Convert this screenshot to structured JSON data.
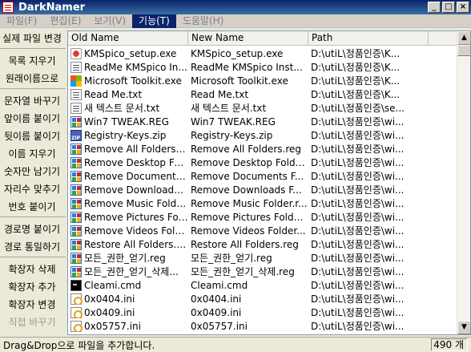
{
  "window": {
    "title": "DarkNamer"
  },
  "menu": [
    "파일(F)",
    "편집(E)",
    "보기(V)",
    "기능(T)",
    "도움말(H)"
  ],
  "sidebar": {
    "group1": [
      "실제 파일 변경"
    ],
    "group2": [
      "목록 지우기",
      "원래이름으로"
    ],
    "group3": [
      "문자열 바꾸기",
      "앞이름 붙이기",
      "뒷이름 붙이기",
      "이름 지우기",
      "숫자만 남기기",
      "자리수 맞추기",
      "번호 붙이기"
    ],
    "group4": [
      "경로명 붙이기",
      "경로 통일하기"
    ],
    "group5": [
      "확장자 삭제",
      "확장자 추가",
      "확장자 변경",
      "직접 바꾸기"
    ]
  },
  "list": {
    "headers": {
      "old": "Old Name",
      "new": "New Name",
      "path": "Path"
    },
    "rows": [
      {
        "icon": "setup",
        "old": "KMSpico_setup.exe",
        "new": "KMSpico_setup.exe",
        "path": "D:\\utiL\\정품인증\\K..."
      },
      {
        "icon": "text",
        "old": "ReadMe KMSpico In...",
        "new": "ReadMe KMSpico Inst...",
        "path": "D:\\utiL\\정품인증\\K..."
      },
      {
        "icon": "ms",
        "old": "Microsoft Toolkit.exe",
        "new": "Microsoft Toolkit.exe",
        "path": "D:\\utiL\\정품인증\\K..."
      },
      {
        "icon": "text",
        "old": "Read Me.txt",
        "new": "Read Me.txt",
        "path": "D:\\utiL\\정품인증\\K..."
      },
      {
        "icon": "text",
        "old": "새 텍스트 문서.txt",
        "new": "새 텍스트 문서.txt",
        "path": "D:\\utiL\\정품인증\\se..."
      },
      {
        "icon": "reg",
        "old": "Win7 TWEAK.REG",
        "new": "Win7 TWEAK.REG",
        "path": "D:\\utiL\\정품인증\\wi..."
      },
      {
        "icon": "zip",
        "old": "Registry-Keys.zip",
        "new": "Registry-Keys.zip",
        "path": "D:\\utiL\\정품인증\\wi..."
      },
      {
        "icon": "reg",
        "old": "Remove All Folders.reg",
        "new": "Remove All Folders.reg",
        "path": "D:\\utiL\\정품인증\\wi..."
      },
      {
        "icon": "reg",
        "old": "Remove Desktop Fol...",
        "new": "Remove Desktop Folde...",
        "path": "D:\\utiL\\정품인증\\wi..."
      },
      {
        "icon": "reg",
        "old": "Remove Documents ...",
        "new": "Remove Documents F...",
        "path": "D:\\utiL\\정품인증\\wi..."
      },
      {
        "icon": "reg",
        "old": "Remove Downloads ...",
        "new": "Remove Downloads F...",
        "path": "D:\\utiL\\정품인증\\wi..."
      },
      {
        "icon": "reg",
        "old": "Remove Music Folde...",
        "new": "Remove Music Folder.r...",
        "path": "D:\\utiL\\정품인증\\wi..."
      },
      {
        "icon": "reg",
        "old": "Remove Pictures Fol...",
        "new": "Remove Pictures Folde...",
        "path": "D:\\utiL\\정품인증\\wi..."
      },
      {
        "icon": "reg",
        "old": "Remove Videos Fold...",
        "new": "Remove Videos Folder...",
        "path": "D:\\utiL\\정품인증\\wi..."
      },
      {
        "icon": "reg",
        "old": "Restore All Folders.reg",
        "new": "Restore All Folders.reg",
        "path": "D:\\utiL\\정품인증\\wi..."
      },
      {
        "icon": "reg",
        "old": "모든_권한_얻기.reg",
        "new": "모든_권한_얻기.reg",
        "path": "D:\\utiL\\정품인증\\wi..."
      },
      {
        "icon": "reg",
        "old": "모든_권한_얻기_삭제...",
        "new": "모든_권한_얻기_삭제.reg",
        "path": "D:\\utiL\\정품인증\\wi..."
      },
      {
        "icon": "cmd",
        "old": "Cleami.cmd",
        "new": "Cleami.cmd",
        "path": "D:\\utiL\\정품인증\\wi..."
      },
      {
        "icon": "ini",
        "old": "0x0404.ini",
        "new": "0x0404.ini",
        "path": "D:\\utiL\\정품인증\\wi..."
      },
      {
        "icon": "ini",
        "old": "0x0409.ini",
        "new": "0x0409.ini",
        "path": "D:\\utiL\\정품인증\\wi..."
      },
      {
        "icon": "ini",
        "old": "0x05757.ini",
        "new": "0x05757.ini",
        "path": "D:\\utiL\\정품인증\\wi..."
      }
    ]
  },
  "status": {
    "message": "Drag&Drop으로 파일을 추가합니다.",
    "count": "490 개"
  },
  "colors": {
    "titlebar": "#0a246a",
    "menu_active": "#0a246a"
  }
}
